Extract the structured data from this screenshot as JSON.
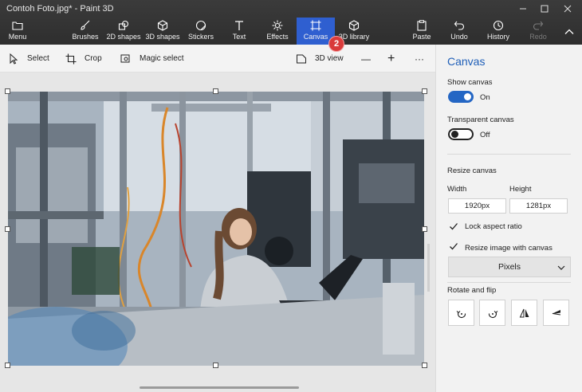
{
  "window": {
    "title": "Contoh Foto.jpg* - Paint 3D"
  },
  "ribbon": {
    "menu": "Menu",
    "tools": [
      {
        "label": "Brushes",
        "icon": "brush-icon"
      },
      {
        "label": "2D shapes",
        "icon": "2d-shapes-icon"
      },
      {
        "label": "3D shapes",
        "icon": "3d-shapes-icon"
      },
      {
        "label": "Stickers",
        "icon": "stickers-icon"
      },
      {
        "label": "Text",
        "icon": "text-icon"
      },
      {
        "label": "Effects",
        "icon": "effects-icon"
      },
      {
        "label": "Canvas",
        "icon": "canvas-icon",
        "active": true
      },
      {
        "label": "3D library",
        "icon": "3d-library-icon"
      }
    ],
    "actions": [
      {
        "label": "Paste",
        "icon": "paste-icon"
      },
      {
        "label": "Undo",
        "icon": "undo-icon"
      },
      {
        "label": "History",
        "icon": "history-icon"
      },
      {
        "label": "Redo",
        "icon": "redo-icon",
        "disabled": true
      }
    ],
    "badge": "2",
    "accent": "#2f5fd0"
  },
  "toolbar": {
    "select": "Select",
    "crop": "Crop",
    "magic_select": "Magic select",
    "view_3d": "3D view",
    "zoom_out": "—",
    "zoom_in": "+",
    "more": "···"
  },
  "panel": {
    "title": "Canvas",
    "show_canvas": {
      "label": "Show canvas",
      "state": "On"
    },
    "transparent_canvas": {
      "label": "Transparent canvas",
      "state": "Off"
    },
    "resize_canvas": "Resize canvas",
    "width_label": "Width",
    "height_label": "Height",
    "width_value": "1920px",
    "height_value": "1281px",
    "lock_aspect": "Lock aspect ratio",
    "resize_image": "Resize image with canvas",
    "unit": "Pixels",
    "rotate_flip": "Rotate and flip"
  }
}
